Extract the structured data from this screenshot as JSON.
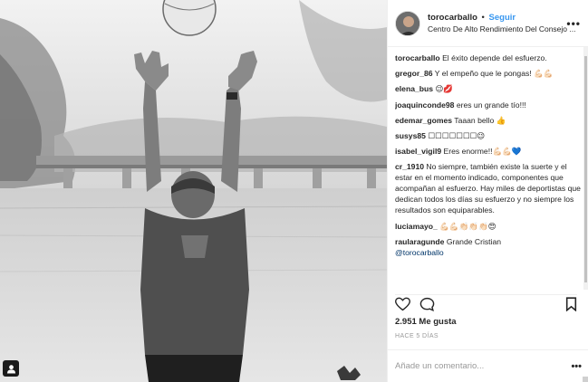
{
  "header": {
    "username": "toroca̲rballo",
    "follow_label": "Seguir",
    "separator": "•",
    "location": "Centro De Alto Rendimiento Del Consejo ...",
    "more": "•••"
  },
  "comments": [
    {
      "user": "torocarballo",
      "text": "El éxito depende del esfuerzo."
    },
    {
      "user": "gregor_86",
      "text": "Y el empeño que le pongas! 💪🏻💪🏻"
    },
    {
      "user": "elena_bus",
      "text": "😉💋"
    },
    {
      "user": "joaquinconde98",
      "text": "eres un grande tío!!!"
    },
    {
      "user": "edemar_gomes",
      "text": "Taaan bello 👍"
    },
    {
      "user": "susys85",
      "text": "☐☐☐☐☐☐☐😉"
    },
    {
      "user": "isabel_vigil9",
      "text": "Eres enorme!!💪🏻💪🏻💙"
    },
    {
      "user": "cr_1910",
      "text": "No siempre, también existe la suerte y el estar en el momento indicado, componentes que acompañan al esfuerzo. Hay miles de deportistas que dedican todos los días su esfuerzo y no siempre los resultados son equiparables."
    },
    {
      "user": "luciamayo_",
      "text": "💪🏻💪🏻👏🏻👏🏻👏🏻😍"
    },
    {
      "user": "raularagunde",
      "text": "Grande Cristian",
      "mention": "@torocarballo"
    }
  ],
  "likes": "2.951 Me gusta",
  "date": "HACE 5 DÍAS",
  "add_comment_placeholder": "Añade un comentario...",
  "add_more": "•••",
  "icons": {
    "like": "heart-icon",
    "comment": "comment-icon",
    "save": "bookmark-icon",
    "user_tag": "person-icon"
  }
}
